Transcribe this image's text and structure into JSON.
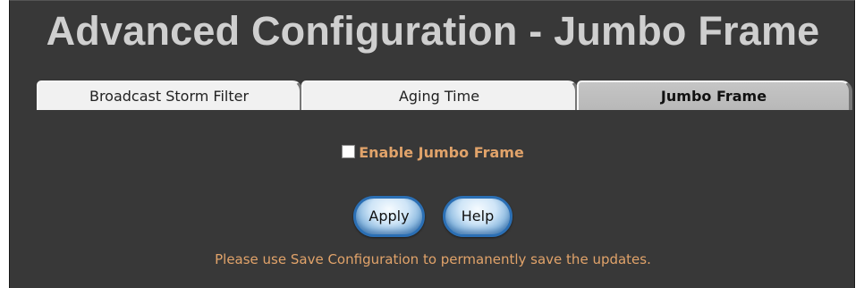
{
  "page": {
    "title": "Advanced Configuration - Jumbo Frame"
  },
  "tabs": [
    {
      "label": "Broadcast Storm Filter",
      "active": false
    },
    {
      "label": "Aging Time",
      "active": false
    },
    {
      "label": "Jumbo Frame",
      "active": true
    }
  ],
  "form": {
    "enable_jumbo_frame_label": "Enable Jumbo Frame",
    "enable_jumbo_frame_checked": false
  },
  "buttons": {
    "apply_label": "Apply",
    "help_label": "Help"
  },
  "note": "Please use Save Configuration to permanently save the updates.",
  "colors": {
    "background": "#383838",
    "title": "#cfcfcf",
    "accent_text": "#e1a36a",
    "button_border": "#2b6fb4"
  }
}
